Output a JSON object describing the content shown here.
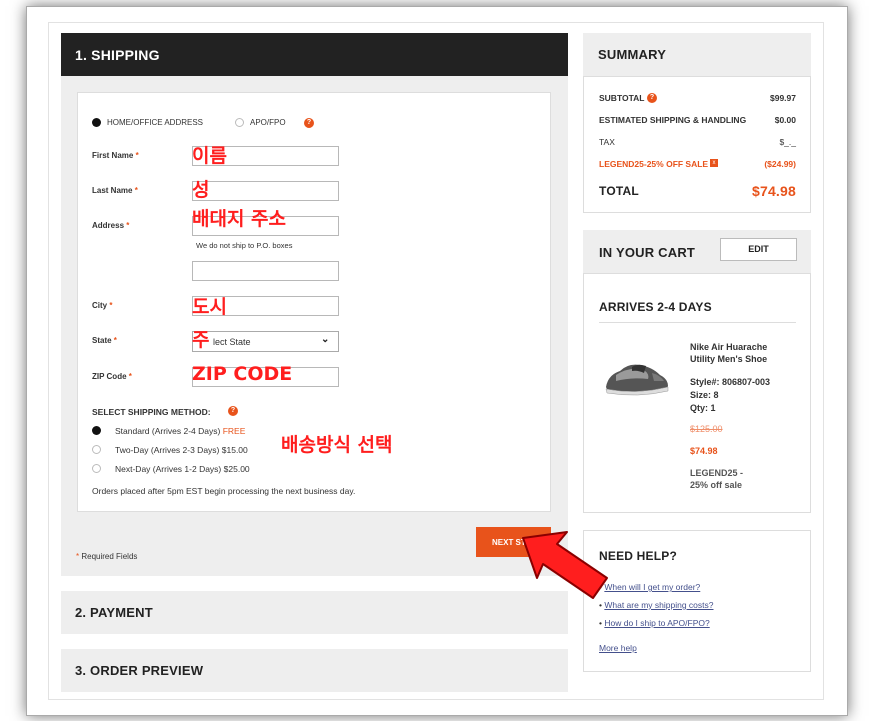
{
  "shipping": {
    "header": "1. SHIPPING",
    "address_type_home": "HOME/OFFICE ADDRESS",
    "address_type_apo": "APO/FPO",
    "fields": {
      "first_name": "First Name",
      "last_name": "Last Name",
      "address": "Address",
      "address_note": "We do not ship to P.O. boxes",
      "city": "City",
      "state": "State",
      "zip": "ZIP Code"
    },
    "required_mark": "*",
    "state_select_value": "lect State",
    "method_title": "SELECT SHIPPING METHOD:",
    "methods": [
      {
        "label": "Standard (Arrives 2-4 Days)",
        "price": "FREE"
      },
      {
        "label": "Two-Day (Arrives 2-3 Days)",
        "price": "$15.00"
      },
      {
        "label": "Next-Day (Arrives 1-2 Days)",
        "price": "$25.00"
      }
    ],
    "footnote": "Orders placed after 5pm EST begin processing the next business day.",
    "required_fields": "Required Fields",
    "next_button": "NEXT ST"
  },
  "annotations": {
    "first_name": "이름",
    "last_name": "성",
    "address": "배대지 주소",
    "city": "도시",
    "state": "주",
    "zip": "ZIP CODE",
    "shipping_method": "배송방식 선택"
  },
  "steps": {
    "payment": "2. PAYMENT",
    "preview": "3. ORDER PREVIEW"
  },
  "summary": {
    "header": "SUMMARY",
    "subtotal_label": "SUBTOTAL",
    "subtotal_value": "$99.97",
    "shipping_label": "ESTIMATED SHIPPING & HANDLING",
    "shipping_value": "$0.00",
    "tax_label": "TAX",
    "tax_value": "$_._",
    "promo_label": "LEGEND25-25% OFF SALE",
    "promo_value": "($24.99)",
    "total_label": "TOTAL",
    "total_value": "$74.98"
  },
  "cart": {
    "header": "IN YOUR CART",
    "edit_button": "EDIT",
    "arrives": "ARRIVES 2-4 DAYS",
    "item_name_1": "Nike Air Huarache",
    "item_name_2": "Utility Men's Shoe",
    "style": "Style#: 806807-003",
    "size": "Size:  8",
    "qty": "Qty: 1",
    "orig_price": "$125.00",
    "sale_price": "$74.98",
    "promo_1": "LEGEND25  -",
    "promo_2": "25% off sale"
  },
  "help": {
    "header": "NEED HELP?",
    "links": [
      "When will I get my order?",
      "What are my shipping costs?",
      "How do I ship to APO/FPO?"
    ],
    "more": "More help"
  },
  "colors": {
    "accent": "#e8531b",
    "annotation": "#ff1e1e",
    "header_dark": "#222222"
  }
}
